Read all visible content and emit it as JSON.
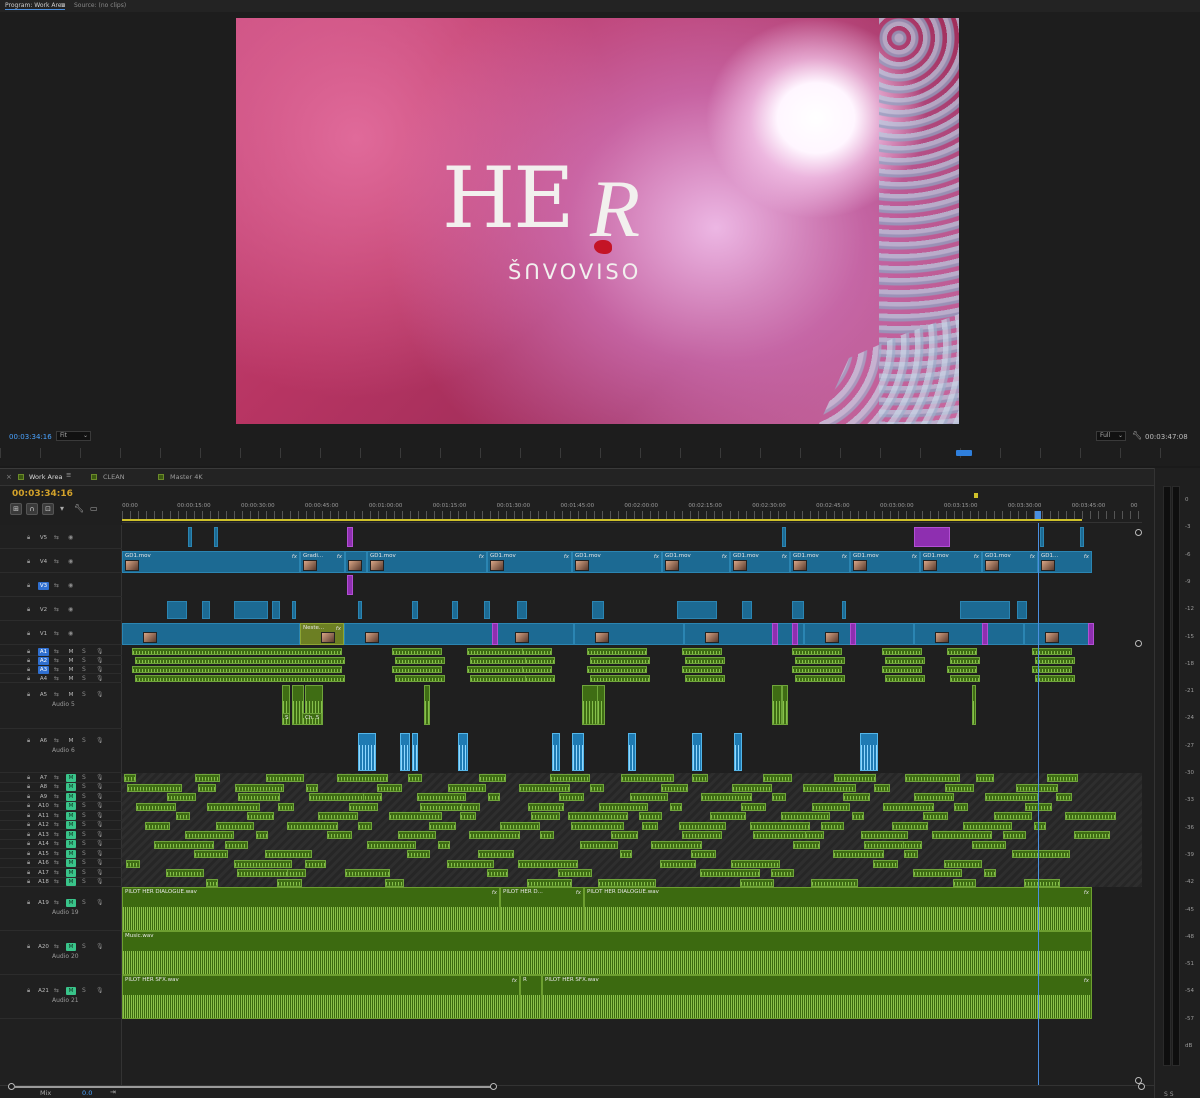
{
  "monitor": {
    "tabs": [
      {
        "label": "Program: Work Area",
        "active": true
      },
      {
        "label": "Source: (no clips)",
        "active": false
      }
    ],
    "frame": {
      "title": "HER",
      "subtitle": "ŠՈVOVISO"
    },
    "timecode": "00:03:34:16",
    "zoom": "Fit",
    "resolution": "Full",
    "duration": "00:03:47:08"
  },
  "timeline": {
    "tabs": [
      {
        "label": "Work Area",
        "active": true
      },
      {
        "label": "CLEAN",
        "active": false
      },
      {
        "label": "Master 4K",
        "active": false
      }
    ],
    "timecode": "00:03:34:16",
    "ruler_labels": [
      "00:00",
      "00:00:15:00",
      "00:00:30:00",
      "00:00:45:00",
      "00:01:00:00",
      "00:01:15:00",
      "00:01:30:00",
      "00:01:45:00",
      "00:02:00:00",
      "00:02:15:00",
      "00:02:30:00",
      "00:02:45:00",
      "00:03:00:00",
      "00:03:15:00",
      "00:03:30:00",
      "00:03:45:00",
      "00"
    ],
    "video_tracks": [
      {
        "name": "V5"
      },
      {
        "name": "V4"
      },
      {
        "name": "V3"
      },
      {
        "name": "V2"
      },
      {
        "name": "V1"
      }
    ],
    "audio_tracks_small": [
      {
        "name": "A1"
      },
      {
        "name": "A2"
      },
      {
        "name": "A3"
      },
      {
        "name": "A4"
      }
    ],
    "audio5": {
      "id": "A5",
      "name": "Audio 5"
    },
    "audio6": {
      "id": "A6",
      "name": "Audio 6"
    },
    "audio_group": [
      {
        "name": "A7"
      },
      {
        "name": "A8"
      },
      {
        "name": "A9"
      },
      {
        "name": "A10"
      },
      {
        "name": "A11"
      },
      {
        "name": "A12"
      },
      {
        "name": "A13"
      },
      {
        "name": "A14"
      },
      {
        "name": "A15"
      },
      {
        "name": "A16"
      },
      {
        "name": "A17"
      },
      {
        "name": "A18"
      }
    ],
    "audio19": {
      "id": "A19",
      "name": "Audio 19"
    },
    "audio20": {
      "id": "A20",
      "name": "Audio 20"
    },
    "audio21": {
      "id": "A21",
      "name": "Audio 21"
    },
    "clips": {
      "gd1": "GD1.mov",
      "gradi": "Gradi...",
      "neste": "Neste...",
      "gd1_short": "GD1...",
      "dialogue": "PILOT HER DIALOGUE.wav",
      "dialogue_short": "PILOT HER D...",
      "music": "Music.wav",
      "sfx": "PILOT HER SFX.wav",
      "ch5": "Ch. 5",
      "fx": "fx",
      "letter_s": "S",
      "letter_r": "R"
    },
    "button_labels": {
      "mute": "M",
      "solo": "S"
    },
    "mix": {
      "label": "Mix",
      "value": "0.0"
    }
  },
  "meters": {
    "db_labels": [
      "0",
      "-3",
      "-6",
      "-9",
      "-12",
      "-15",
      "-18",
      "-21",
      "-24",
      "-27",
      "-30",
      "-33",
      "-36",
      "-39",
      "-42",
      "-45",
      "-48",
      "-51",
      "-54",
      "-57",
      "dB"
    ],
    "channel_labels": "S S"
  },
  "colors": {
    "video_clip": "#1c6a93",
    "audio_clip": "#3f6d14",
    "adjustment_clip": "#8e2fb0",
    "playhead": "#4a8fe0",
    "timecode_accent": "#d3a22a"
  }
}
